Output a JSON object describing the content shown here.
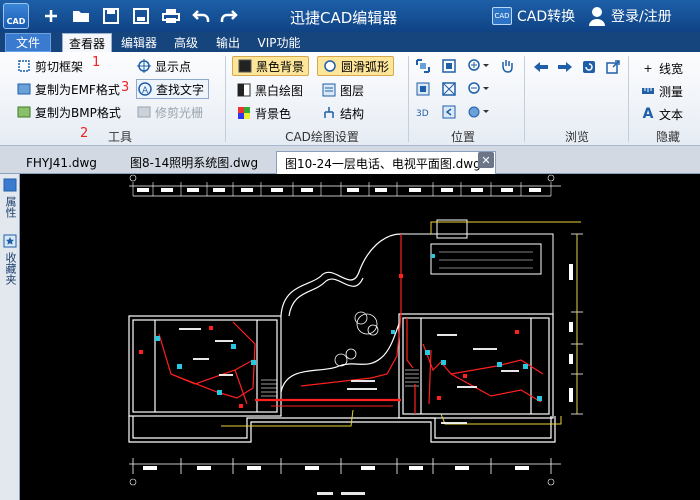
{
  "app": {
    "title": "迅捷CAD编辑器",
    "logo_text": "CAD",
    "cad_convert": "CAD转换",
    "login": "登录/注册",
    "convert_icon_text": "CAD"
  },
  "quick_access": [
    "new-icon",
    "open-icon",
    "save-icon",
    "save-as-icon",
    "print-icon",
    "undo-icon",
    "redo-icon"
  ],
  "menu": {
    "file": "文件",
    "tabs": [
      "查看器",
      "编辑器",
      "高级",
      "输出",
      "VIP功能"
    ]
  },
  "ribbon": {
    "tools": {
      "clip_frame": "剪切框架",
      "copy_emf": "复制为EMF格式",
      "copy_bmp": "复制为BMP格式",
      "show_points": "显示点",
      "find_text": "查找文字",
      "trim_raster": "修剪光栅",
      "label": "工具"
    },
    "cad_settings": {
      "black_bg": "黑色背景",
      "smooth_arc": "圆滑弧形",
      "bw_drawing": "黑白绘图",
      "layers": "图层",
      "bg_color": "背景色",
      "structure": "结构",
      "label": "CAD绘图设置"
    },
    "position": {
      "label": "位置"
    },
    "browse": {
      "label": "浏览"
    },
    "hide": {
      "linewidth": "线宽",
      "measure": "测量",
      "text": "文本",
      "label": "隐藏"
    },
    "annotations": [
      "1",
      "2",
      "3"
    ]
  },
  "doc_tabs": [
    "FHYJ41.dwg",
    "图8-14照明系统图.dwg",
    "图10-24一层电话、电视平面图.dwg"
  ],
  "side_tabs": [
    "属性",
    "收藏夹"
  ],
  "colors": {
    "title_bar": "#1d5fa8",
    "menu_bar": "#16447c",
    "canvas": "#000000",
    "highlight": "#fde59a",
    "cad_white": "#ffffff",
    "cad_red": "#ff2020",
    "cad_yellow": "#e8d23a",
    "cad_cyan": "#28c8e0"
  }
}
